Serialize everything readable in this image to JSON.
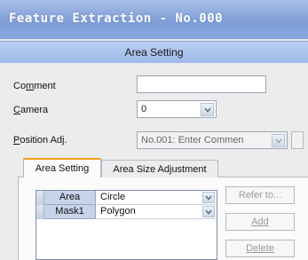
{
  "window": {
    "title": "Feature Extraction - No.000"
  },
  "section": {
    "header": "Area Setting"
  },
  "fields": {
    "comment_label_pre": "Co",
    "comment_label_ul": "m",
    "comment_label_post": "ment",
    "comment_value": "",
    "camera_label_ul": "C",
    "camera_label_post": "amera",
    "camera_value": "0",
    "position_label_ul": "P",
    "position_label_post": "osition Adj.",
    "position_value": "No.001: Enter Commen"
  },
  "tabs": [
    {
      "label": "Area Setting",
      "active": true
    },
    {
      "label": "Area Size Adjustment",
      "active": false
    }
  ],
  "grid": {
    "rows": [
      {
        "name": "Area",
        "value": "Circle"
      },
      {
        "name": "Mask1",
        "value": "Polygon"
      }
    ]
  },
  "buttons": {
    "refer_to": "Refer to...",
    "add": "Add",
    "delete": "Delete"
  },
  "colors": {
    "title_bar": "#7f9ed6",
    "active_tab_accent": "#f2a516"
  },
  "icons": {
    "dropdown": "chevron-down-icon"
  }
}
